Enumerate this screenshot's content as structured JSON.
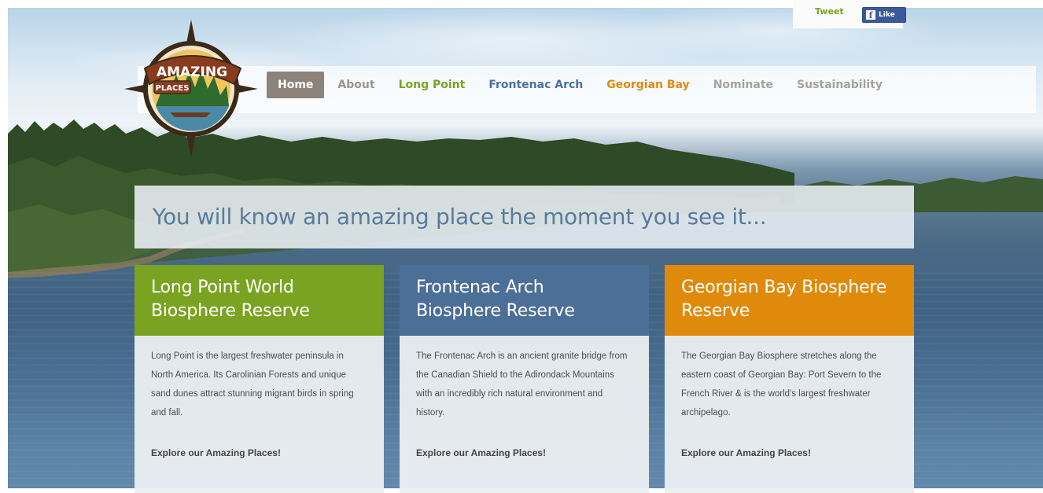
{
  "social": {
    "tweet_label": "Tweet",
    "like_label": "Like"
  },
  "logo": {
    "text_top": "AMAZING",
    "text_bottom": "PLACES"
  },
  "nav": {
    "items": [
      {
        "label": "Home",
        "active": true
      },
      {
        "label": "About"
      },
      {
        "label": "Long Point"
      },
      {
        "label": "Frontenac Arch"
      },
      {
        "label": "Georgian Bay"
      },
      {
        "label": "Nominate"
      },
      {
        "label": "Sustainability"
      }
    ]
  },
  "tagline": "You will know an amazing place the moment you see it...",
  "cards": [
    {
      "title": "Long Point World Biosphere Reserve",
      "description": "Long Point is the largest freshwater peninsula in North America. Its Carolinian Forests and unique sand dunes attract stunning migrant birds in spring and fall.",
      "cta": "Explore our Amazing Places!",
      "color": "#7aa321"
    },
    {
      "title": "Frontenac Arch Biosphere Reserve",
      "description": "The Frontenac Arch is an ancient granite bridge from the Canadian Shield to the Adirondack Mountains with an incredibly rich natural environment and history.",
      "cta": "Explore our Amazing Places!",
      "color": "#4c6f97"
    },
    {
      "title": "Georgian Bay Biosphere Reserve",
      "description": "The Georgian Bay Biosphere stretches along the eastern coast of Georgian Bay: Port Severn to the French River & is the world's largest freshwater archipelago.",
      "cta": "Explore our Amazing Places!",
      "color": "#e08a0c"
    }
  ]
}
